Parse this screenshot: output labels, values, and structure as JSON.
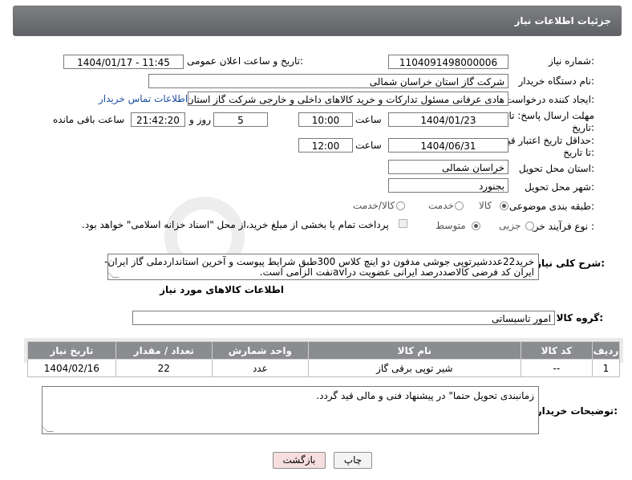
{
  "header": {
    "title": "جزئیات اطلاعات نیاز"
  },
  "fields": {
    "need_number_label": "شماره نیاز:",
    "need_number": "1104091498000006",
    "announce_label": "تاریخ و ساعت اعلان عمومی:",
    "announce_value": "1404/01/17 - 11:45",
    "buyer_org_label": "نام دستگاه خریدار:",
    "buyer_org": "شرکت گاز استان خراسان شمالی",
    "creator_label": "ایجاد کننده درخواست:",
    "creator": "هادی عرفانی مسئول تدارکات و خرید کالاهای داخلی و خارجی شرکت گاز استان",
    "contact_link": "اطلاعات تماس خریدار",
    "deadline_label_1": "مهلت ارسال پاسخ: تا",
    "deadline_label_2": "تاریخ:",
    "deadline_date": "1404/01/23",
    "time_label": "ساعت",
    "deadline_time": "10:00",
    "days_value": "5",
    "days_label": "روز و",
    "remaining_time": "21:42:20",
    "remaining_label": "ساعت باقی مانده",
    "validity_label_1": "حداقل تاریخ اعتبار قیمت:",
    "validity_label_2": "تا تاریخ:",
    "validity_date": "1404/06/31",
    "validity_time": "12:00",
    "province_label": "استان محل تحویل:",
    "province": "خراسان شمالی",
    "city_label": "شهر محل تحویل:",
    "city": "بجنورد",
    "category_label": "طبقه بندی موضوعی:",
    "category_options": [
      "کالا",
      "خدمت",
      "کالا/خدمت"
    ],
    "category_selected": "کالا",
    "process_label": "نوع فرآیند خرید :",
    "process_options": [
      "جزیی",
      "متوسط"
    ],
    "process_selected": "متوسط",
    "payment_note": "پرداخت تمام یا بخشی از مبلغ خرید،از محل \"اسناد خزانه اسلامی\" خواهد بود.",
    "description_label": "شرح کلی نیاز:",
    "description_line1": "خرید22عددشیرتوپی جوشی مدفون دو اینچ کلاس 300طبق شرایط پیوست و آخرین استانداردملی گاز ایران-",
    "description_line2": "ایران کد فرضی کالاصددرصد ایرانی عضویت درavlنفت الزامی است."
  },
  "goods": {
    "section_title": "اطلاعات کالاهای مورد نیاز",
    "group_label": "گروه کالا:",
    "group_value": "امور تاسیساتی",
    "columns": [
      "ردیف",
      "کد کالا",
      "نام کالا",
      "واحد شمارش",
      "تعداد / مقدار",
      "تاریخ نیاز"
    ],
    "rows": [
      [
        "1",
        "--",
        "شیر توپی برقی گاز",
        "عدد",
        "22",
        "1404/02/16"
      ]
    ]
  },
  "notes": {
    "label": "توضیحات خریدار:",
    "text": "زمانبندی تحویل حتما\" در پیشنهاد فنی و مالی قید گردد."
  },
  "buttons": {
    "print": "چاپ",
    "back": "بازگشت"
  },
  "colors": {
    "header_bg": "#6e7073",
    "table_head_bg": "#8a8c8f",
    "link": "#1a4fa3",
    "back_button_bg": "#f7dede"
  }
}
